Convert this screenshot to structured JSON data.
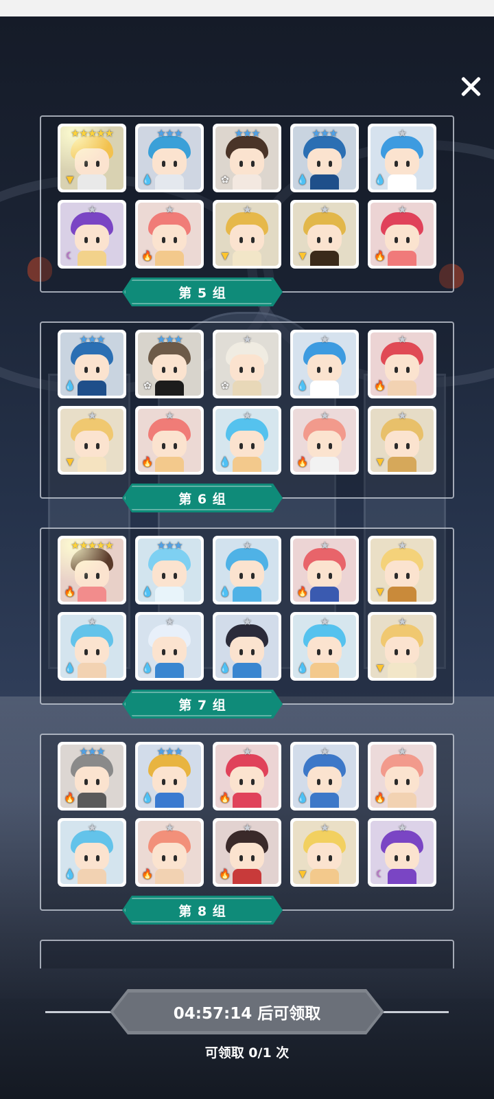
{
  "close_icon": "close-icon",
  "groups": [
    {
      "label": "第 5 组",
      "cards": [
        {
          "stars": "★★★★★",
          "rarity": "s5",
          "element": "light",
          "hair": "#f2c14e",
          "bodyc": "#e9e9e9",
          "bg": "#d9d2b2",
          "glow": true
        },
        {
          "stars": "★★★",
          "rarity": "s3",
          "element": "water",
          "hair": "#3aa0d8",
          "bodyc": "#e4e8ee",
          "bg": "#cfd6e2"
        },
        {
          "stars": "★★★",
          "rarity": "s3",
          "element": "wind",
          "hair": "#4a3428",
          "bodyc": "#f3e8e0",
          "bg": "#ddd6ce"
        },
        {
          "stars": "★★★",
          "rarity": "s3",
          "element": "water",
          "hair": "#2b6fb3",
          "bodyc": "#1f4f8a",
          "bg": "#c9d4e0"
        },
        {
          "stars": "★",
          "rarity": "s1",
          "element": "water",
          "hair": "#3d9be0",
          "bodyc": "#ffffff",
          "bg": "#d6e2ee"
        },
        {
          "stars": "★",
          "rarity": "s1",
          "element": "dark",
          "hair": "#7a45c4",
          "bodyc": "#f2d28b",
          "bg": "#d9d0e6"
        },
        {
          "stars": "★",
          "rarity": "s1",
          "element": "fire",
          "hair": "#f07c77",
          "bodyc": "#f3c98c",
          "bg": "#ecd9d4"
        },
        {
          "stars": "★",
          "rarity": "s1",
          "element": "light",
          "hair": "#e6b84a",
          "bodyc": "#f2e6c8",
          "bg": "#e2dac4"
        },
        {
          "stars": "★",
          "rarity": "s1",
          "element": "light",
          "hair": "#e2b74a",
          "bodyc": "#3a2a1a",
          "bg": "#e4dcc6"
        },
        {
          "stars": "★",
          "rarity": "s1",
          "element": "fire",
          "hair": "#e0425a",
          "bodyc": "#f07a7a",
          "bg": "#ecd4d4"
        }
      ]
    },
    {
      "label": "第 6 组",
      "cards": [
        {
          "stars": "★★★",
          "rarity": "s3",
          "element": "water",
          "hair": "#2b6fb3",
          "bodyc": "#1f4f8a",
          "bg": "#c9d4e0"
        },
        {
          "stars": "★★★",
          "rarity": "s3",
          "element": "wind",
          "hair": "#6d5a48",
          "bodyc": "#1c1c1c",
          "bg": "#d8d4cc"
        },
        {
          "stars": "★",
          "rarity": "s1",
          "element": "wind",
          "hair": "#f0ece2",
          "bodyc": "#e8d8b8",
          "bg": "#e0ddd6"
        },
        {
          "stars": "★",
          "rarity": "s1",
          "element": "water",
          "hair": "#3d9be0",
          "bodyc": "#ffffff",
          "bg": "#d6e2ee"
        },
        {
          "stars": "★",
          "rarity": "s1",
          "element": "fire",
          "hair": "#e04a55",
          "bodyc": "#f2d2b2",
          "bg": "#ecd4d4"
        },
        {
          "stars": "★",
          "rarity": "s1",
          "element": "light",
          "hair": "#f0c870",
          "bodyc": "#f5e3c0",
          "bg": "#e8dec8"
        },
        {
          "stars": "★",
          "rarity": "s1",
          "element": "fire",
          "hair": "#f07c77",
          "bodyc": "#f3c98c",
          "bg": "#ecd9d4"
        },
        {
          "stars": "★",
          "rarity": "s1",
          "element": "water",
          "hair": "#55c2ee",
          "bodyc": "#f3c98c",
          "bg": "#d6e6ee"
        },
        {
          "stars": "★",
          "rarity": "s1",
          "element": "fire",
          "hair": "#f29a8c",
          "bodyc": "#f2f2f2",
          "bg": "#ecdada"
        },
        {
          "stars": "★",
          "rarity": "s1",
          "element": "light",
          "hair": "#e8c06a",
          "bodyc": "#d6a85a",
          "bg": "#e6dcc6"
        }
      ]
    },
    {
      "label": "第 7 组",
      "cards": [
        {
          "stars": "★★★★★",
          "rarity": "s5",
          "element": "fire",
          "hair": "#5a3a2a",
          "bodyc": "#f28c8c",
          "bg": "#e8d0c8",
          "glow": true
        },
        {
          "stars": "★★★",
          "rarity": "s3",
          "element": "water",
          "hair": "#7ed0f2",
          "bodyc": "#e8f4fa",
          "bg": "#d2e4ee"
        },
        {
          "stars": "★",
          "rarity": "s1",
          "element": "water",
          "hair": "#4fb2e6",
          "bodyc": "#4fb2e6",
          "bg": "#d2e2ee"
        },
        {
          "stars": "★",
          "rarity": "s1",
          "element": "fire",
          "hair": "#e8646a",
          "bodyc": "#3a5ab0",
          "bg": "#ecd4d4"
        },
        {
          "stars": "★",
          "rarity": "s1",
          "element": "light",
          "hair": "#f4d27a",
          "bodyc": "#c98a3a",
          "bg": "#eadfc6"
        },
        {
          "stars": "★",
          "rarity": "s1",
          "element": "water",
          "hair": "#63c3ea",
          "bodyc": "#f2d2b2",
          "bg": "#d4e4ee"
        },
        {
          "stars": "★",
          "rarity": "s1",
          "element": "water",
          "hair": "#e8f0fa",
          "bodyc": "#3a86d0",
          "bg": "#d6e2ee"
        },
        {
          "stars": "★",
          "rarity": "s1",
          "element": "water",
          "hair": "#2b2b3a",
          "bodyc": "#3a86d0",
          "bg": "#d2dcea"
        },
        {
          "stars": "★",
          "rarity": "s1",
          "element": "water",
          "hair": "#55c2ee",
          "bodyc": "#f3c98c",
          "bg": "#d6e6ee"
        },
        {
          "stars": "★",
          "rarity": "s1",
          "element": "light",
          "hair": "#f0c870",
          "bodyc": "#f2e6c8",
          "bg": "#e8dec8"
        }
      ]
    },
    {
      "label": "第 8 组",
      "cards": [
        {
          "stars": "★★★",
          "rarity": "s3",
          "element": "fire",
          "hair": "#8a8a8a",
          "bodyc": "#5a5a5a",
          "bg": "#dcd6d2"
        },
        {
          "stars": "★★★",
          "rarity": "s3",
          "element": "water",
          "hair": "#e8b440",
          "bodyc": "#3a7ad0",
          "bg": "#d2dcea"
        },
        {
          "stars": "★",
          "rarity": "s1",
          "element": "fire",
          "hair": "#e0425a",
          "bodyc": "#e0425a",
          "bg": "#ecd4d4"
        },
        {
          "stars": "★",
          "rarity": "s1",
          "element": "water",
          "hair": "#3d78c8",
          "bodyc": "#3d78c8",
          "bg": "#d2dcea"
        },
        {
          "stars": "★",
          "rarity": "s1",
          "element": "fire",
          "hair": "#f29a8c",
          "bodyc": "#f2d2b2",
          "bg": "#ecdada"
        },
        {
          "stars": "★",
          "rarity": "s1",
          "element": "water",
          "hair": "#63c3ea",
          "bodyc": "#f2d2b2",
          "bg": "#d4e4ee"
        },
        {
          "stars": "★",
          "rarity": "s1",
          "element": "fire",
          "hair": "#f2907a",
          "bodyc": "#f2d2b2",
          "bg": "#ecdad4"
        },
        {
          "stars": "★",
          "rarity": "s1",
          "element": "fire",
          "hair": "#3a2a2a",
          "bodyc": "#c83a3a",
          "bg": "#e2d2d0"
        },
        {
          "stars": "★",
          "rarity": "s1",
          "element": "light",
          "hair": "#f2d060",
          "bodyc": "#f3c98c",
          "bg": "#eadfc6"
        },
        {
          "stars": "★",
          "rarity": "s1",
          "element": "dark",
          "hair": "#7a45c4",
          "bodyc": "#7a45c4",
          "bg": "#dcd2e8"
        }
      ]
    }
  ],
  "footer": {
    "claim_label": "04:57:14 后可领取",
    "claim_count": "可领取 0/1 次"
  },
  "colors": {
    "label_bg": "#0f8b79",
    "claim_bg": "#7f848c"
  }
}
